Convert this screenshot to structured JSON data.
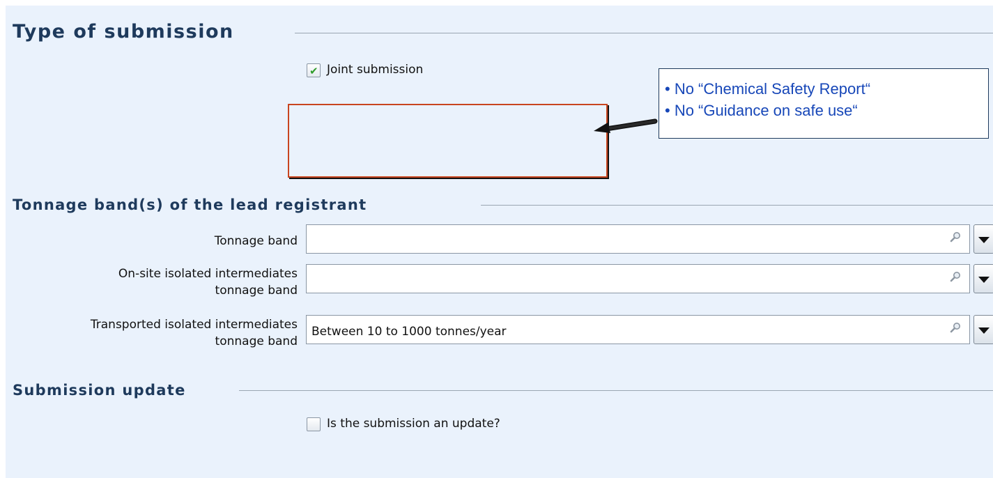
{
  "type_of_submission": {
    "title": "Type of submission",
    "joint_submission": {
      "label": "Joint submission",
      "checked": true
    }
  },
  "callout": {
    "lines": [
      "• No “Chemical Safety Report“",
      "• No “Guidance on safe use“"
    ]
  },
  "tonnage": {
    "title": "Tonnage band(s) of the lead registrant",
    "fields": [
      {
        "label": "Tonnage band",
        "value": ""
      },
      {
        "label_line1": "On-site isolated intermediates",
        "label_line2": "tonnage band",
        "value": ""
      },
      {
        "label_line1": "Transported isolated intermediates",
        "label_line2": "tonnage band",
        "value": "Between 10 to 1000 tonnes/year"
      }
    ]
  },
  "submission_update": {
    "title": "Submission update",
    "is_update": {
      "label": "Is the submission an update?",
      "checked": false
    }
  },
  "colors": {
    "panel_background": "#eaf2fc",
    "heading": "#1e3a5c",
    "highlight_box": "#c8451f",
    "callout_text": "#1747b8",
    "checkmark": "#2f9c2b"
  }
}
